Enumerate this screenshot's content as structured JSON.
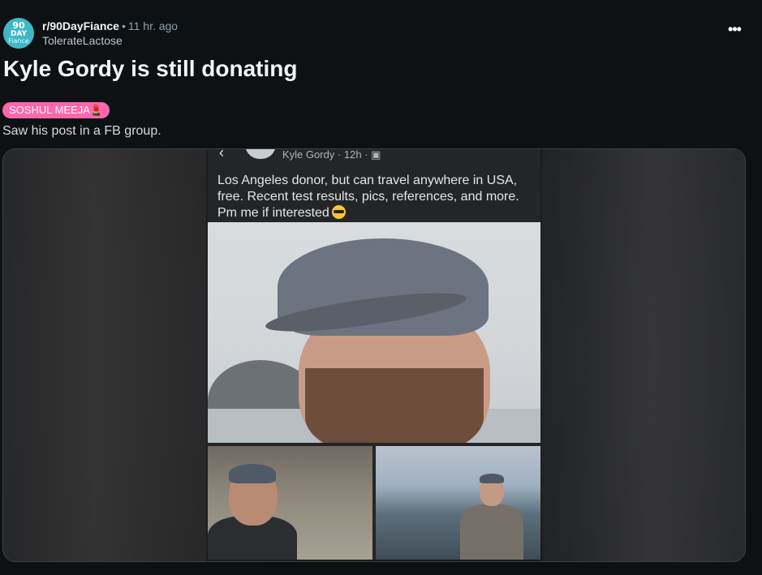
{
  "post": {
    "subreddit": "r/90DayFiance",
    "separator": "•",
    "time": "11 hr. ago",
    "author": "TolerateLactose",
    "more_icon": "more-horizontal-icon",
    "title": "Kyle Gordy is still donating",
    "flair": "SOSHUL MEEJA💄",
    "body": "Saw his post in a FB group."
  },
  "avatar": {
    "line1": "90",
    "line2": "DAY",
    "line3": "Fiance"
  },
  "embedded_fb_post": {
    "back_icon": "back-arrow-icon",
    "poster_line": "Kyle Gordy · 12h · ▣",
    "options_icon": "more-horizontal-icon",
    "text": "Los Angeles donor, but can travel anywhere in USA, free. Recent test results, pics, references, and more. Pm me if interested",
    "emoji": "sunglasses-emoji"
  },
  "colors": {
    "background": "#0e1113",
    "flair": "#ff66ac",
    "subreddit_avatar": "#3fb8c6",
    "fb_post_bg": "#242526"
  }
}
